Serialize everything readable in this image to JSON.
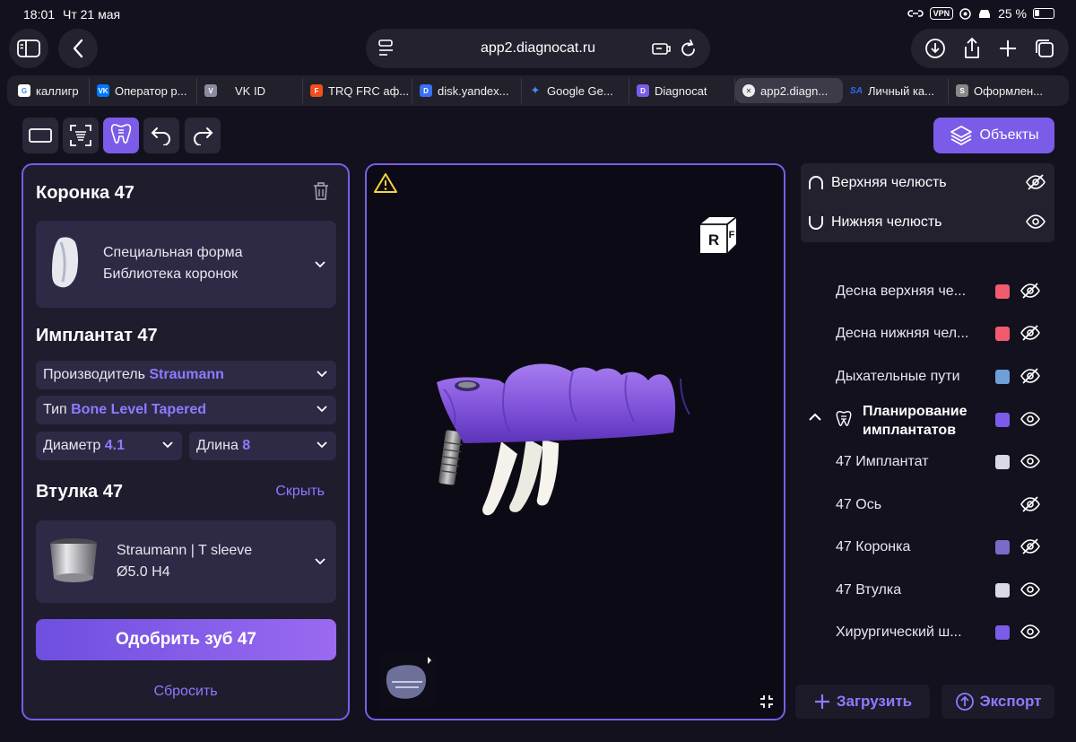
{
  "status_bar": {
    "time": "18:01",
    "date": "Чт 21 мая",
    "vpn": "VPN",
    "battery": "25 %"
  },
  "browser": {
    "url": "app2.diagnocat.ru",
    "tabs": [
      {
        "label": "каллигр",
        "favicon": "G",
        "color": "#ffffff"
      },
      {
        "label": "Оператор р...",
        "favicon": "VK",
        "color": "#0077ff"
      },
      {
        "label": "VK ID",
        "favicon": "V",
        "color": "#8a8aa0"
      },
      {
        "label": "TRQ FRC аф...",
        "favicon": "F",
        "color": "#f24e1e"
      },
      {
        "label": "disk.yandex...",
        "favicon": "D",
        "color": "#3a6ff7"
      },
      {
        "label": "Google Ge...",
        "favicon": "✦",
        "color": "#4a8af4"
      },
      {
        "label": "Diagnocat",
        "favicon": "D",
        "color": "#7b5ce8"
      },
      {
        "label": "app2.diagn...",
        "favicon": "✕",
        "color": "#555"
      },
      {
        "label": "Личный ка...",
        "favicon": "SA",
        "color": "#2a6df4"
      },
      {
        "label": "Оформлен...",
        "favicon": "S",
        "color": "#888"
      }
    ]
  },
  "toolbar": {
    "objects_label": "Объекты"
  },
  "left_panel": {
    "crown_title": "Коронка 47",
    "crown_card": {
      "line1": "Специальная форма",
      "line2": "Библиотека коронок"
    },
    "implant_title": "Имплантат 47",
    "manufacturer": {
      "label": "Производитель",
      "value": "Straumann"
    },
    "type": {
      "label": "Тип",
      "value": "Bone Level Tapered"
    },
    "diameter": {
      "label": "Диаметр",
      "value": "4.1"
    },
    "length": {
      "label": "Длина",
      "value": "8"
    },
    "sleeve_title": "Втулка 47",
    "hide_label": "Скрыть",
    "sleeve_card": {
      "line1": "Straumann | T sleeve",
      "line2": "Ø5.0 H4"
    },
    "approve_label": "Одобрить зуб 47",
    "reset_label": "Сбросить"
  },
  "viewport": {
    "cube_face_front": "R",
    "cube_face_side": "F"
  },
  "right_panel": {
    "upper_jaw": "Верхняя челюсть",
    "lower_jaw": "Нижняя челюсть",
    "objects": [
      {
        "label": "Десна верхняя че...",
        "color": "#f25a6e",
        "visible": false
      },
      {
        "label": "Десна нижняя чел...",
        "color": "#f25a6e",
        "visible": false
      },
      {
        "label": "Дыхательные пути",
        "color": "#6f9fd8",
        "visible": false
      },
      {
        "label": "Планирование имплантатов",
        "color": "#7b5ce8",
        "visible": true
      },
      {
        "label": "47 Имплантат",
        "color": "#d8dae8",
        "visible": true
      },
      {
        "label": "47 Ось",
        "color": "",
        "visible": false
      },
      {
        "label": "47 Коронка",
        "color": "#7b6bc8",
        "visible": false
      },
      {
        "label": "47 Втулка",
        "color": "#d8dae8",
        "visible": true
      },
      {
        "label": "Хирургический ш...",
        "color": "#7b5ce8",
        "visible": true
      }
    ],
    "upload_label": "Загрузить",
    "export_label": "Экспорт"
  }
}
